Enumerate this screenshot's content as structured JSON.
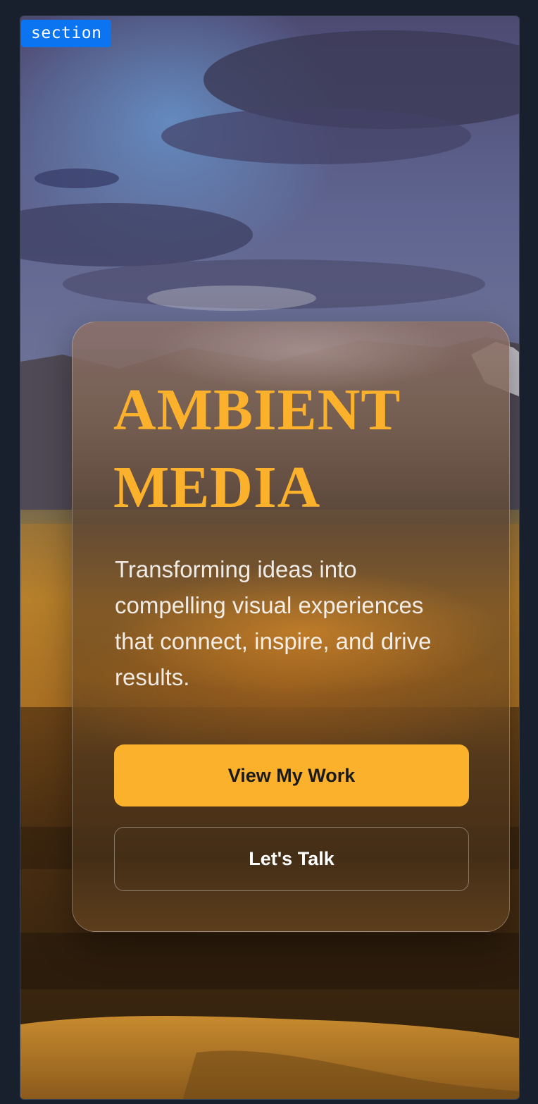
{
  "badge": {
    "label": "section"
  },
  "hero": {
    "title_line1": "AMBIENT",
    "title_line2": "MEDIA",
    "subtitle": "Transforming ideas into compelling visual experiences that connect, inspire, and drive results."
  },
  "buttons": {
    "primary_label": "View My Work",
    "secondary_label": "Let's Talk"
  },
  "colors": {
    "accent": "#fbb12c",
    "page_background": "#19202d",
    "badge": "#0b74f0"
  }
}
